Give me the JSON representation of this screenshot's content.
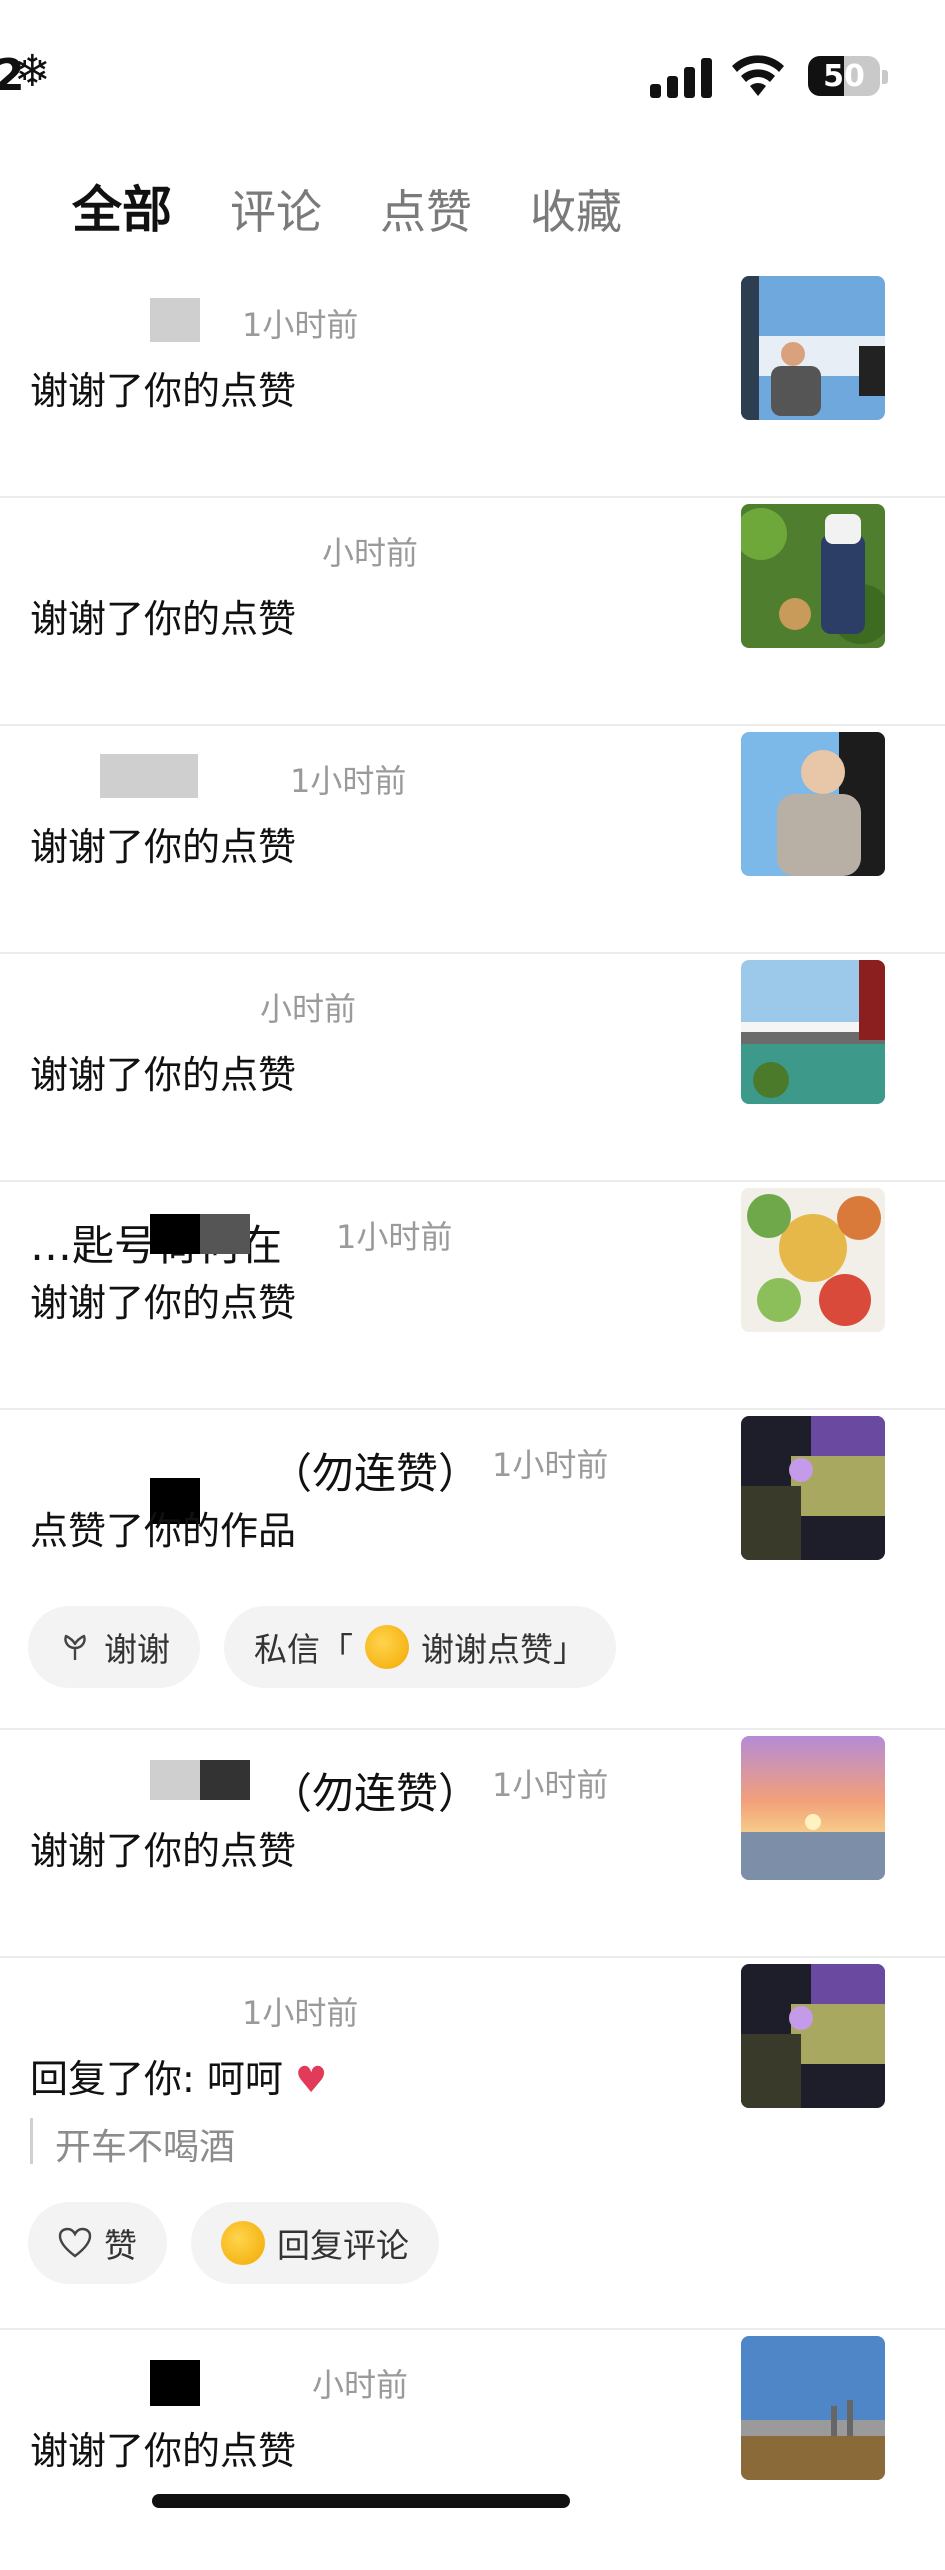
{
  "status_bar": {
    "time_fragment": "2",
    "snow_icon": "❄",
    "battery": "50"
  },
  "tabs": [
    {
      "label": "全部",
      "active": true
    },
    {
      "label": "评论",
      "active": false
    },
    {
      "label": "点赞",
      "active": false
    },
    {
      "label": "收藏",
      "active": false
    }
  ],
  "items": [
    {
      "name": "",
      "time": "1小时前",
      "message": "谢谢了你的点赞"
    },
    {
      "name": "",
      "time": "小时前",
      "message": "谢谢了你的点赞"
    },
    {
      "name": "",
      "time": "1小时前",
      "message": "谢谢了你的点赞"
    },
    {
      "name": "",
      "time": "小时前",
      "message": "谢谢了你的点赞"
    },
    {
      "name": "…匙号荷何在",
      "time": "1小时前",
      "message": "谢谢了你的点赞"
    },
    {
      "name": "（勿连赞）",
      "time": "1小时前",
      "message": "点赞了你的作品",
      "actions": {
        "thanks": "谢谢",
        "dm": "私信「",
        "dm_suffix": "谢谢点赞」"
      }
    },
    {
      "name": "（勿连赞）",
      "time": "1小时前",
      "message": "谢谢了你的点赞"
    },
    {
      "name": "",
      "time": "1小时前",
      "message": "回复了你: 呵呵",
      "quote": "开车不喝酒",
      "actions": {
        "like": "赞",
        "reply": "回复评论"
      }
    },
    {
      "name": "",
      "time": "小时前",
      "message": "谢谢了你的点赞"
    }
  ]
}
